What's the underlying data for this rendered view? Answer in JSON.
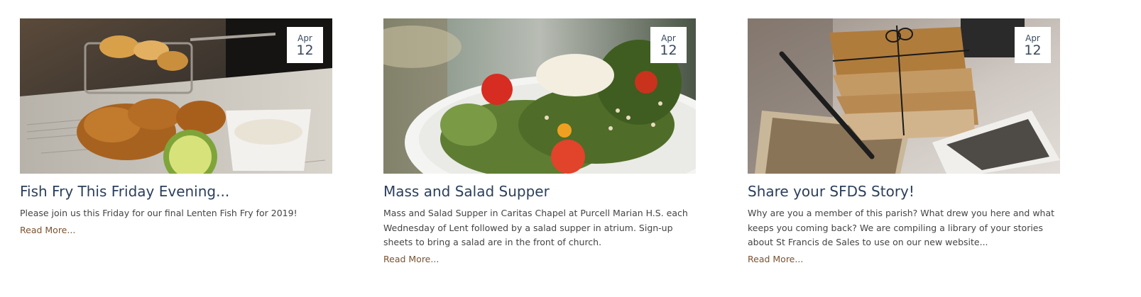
{
  "posts": [
    {
      "date": {
        "month": "Apr",
        "day": "12"
      },
      "title": "Fish Fry This Friday Evening...",
      "excerpt": "Please join us this Friday for our final Lenten Fish Fry for 2019!",
      "read_more": "Read More..."
    },
    {
      "date": {
        "month": "Apr",
        "day": "12"
      },
      "title": "Mass and Salad Supper",
      "excerpt": "Mass and Salad Supper in Caritas Chapel at Purcell Marian H.S. each Wednesday of Lent followed by a salad supper in atrium.  Sign-up sheets to bring a salad are in the front of church.",
      "read_more": "Read More..."
    },
    {
      "date": {
        "month": "Apr",
        "day": "12"
      },
      "title": "Share your SFDS Story!",
      "excerpt": "Why are you a member of this parish? What drew you here and what keeps you coming back? We are compiling a library of your stories about St Francis de Sales to use on our new website...",
      "read_more": "Read More..."
    }
  ]
}
